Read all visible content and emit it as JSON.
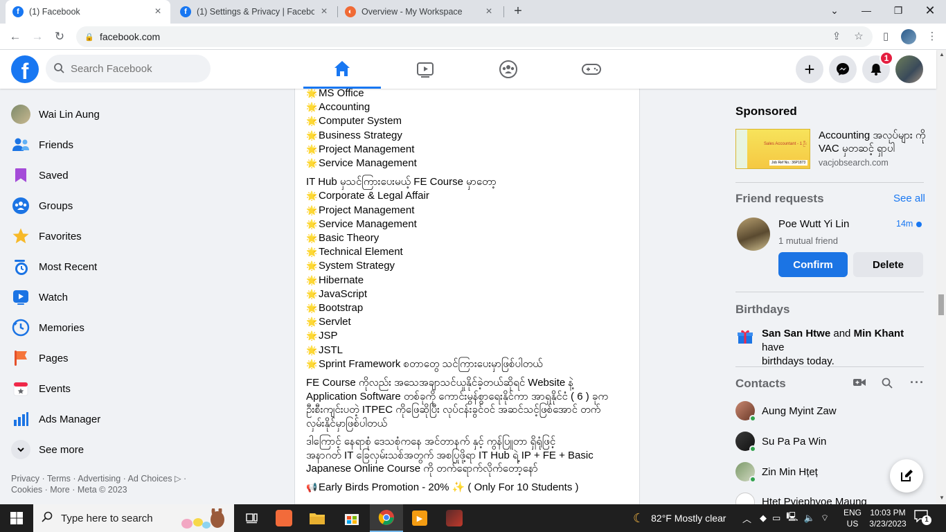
{
  "browser": {
    "tabs": [
      {
        "title": "(1) Facebook",
        "active": true
      },
      {
        "title": "(1) Settings & Privacy | Facebook",
        "active": false
      },
      {
        "title": "Overview - My Workspace",
        "active": false
      }
    ],
    "url": "facebook.com"
  },
  "header": {
    "logo": "f",
    "search_placeholder": "Search Facebook",
    "notification_count": "1"
  },
  "sidebar": {
    "items": [
      {
        "label": "Wai Lin Aung",
        "icon": "profile-avatar"
      },
      {
        "label": "Friends",
        "icon": "friends-icon"
      },
      {
        "label": "Saved",
        "icon": "saved-icon"
      },
      {
        "label": "Groups",
        "icon": "groups-icon"
      },
      {
        "label": "Favorites",
        "icon": "favorites-icon"
      },
      {
        "label": "Most Recent",
        "icon": "most-recent-icon"
      },
      {
        "label": "Watch",
        "icon": "watch-icon"
      },
      {
        "label": "Memories",
        "icon": "memories-icon"
      },
      {
        "label": "Pages",
        "icon": "pages-icon"
      },
      {
        "label": "Events",
        "icon": "events-icon"
      },
      {
        "label": "Ads Manager",
        "icon": "ads-manager-icon"
      },
      {
        "label": "See more",
        "icon": "chevron-down-icon"
      }
    ],
    "footer_line1": "Privacy · Terms · Advertising · Ad Choices ▷ ·",
    "footer_line2": "Cookies · More · Meta © 2023"
  },
  "post": {
    "list1": [
      "MS Office",
      "Accounting",
      "Computer System",
      "Business Strategy",
      "Project Management",
      "Service Management"
    ],
    "fe_intro": "IT Hub မှသင်ကြားပေးမယ့် FE Course မှာတော့",
    "list2": [
      "Corporate & Legal Affair",
      "Project Management",
      "Service Management",
      "Basic Theory",
      "Technical Element",
      "System Strategy",
      "Hibernate",
      "JavaScript",
      "Bootstrap",
      "Servlet",
      "JSP",
      "JSTL",
      "Sprint Framework စတာတွေ သင်ကြားပေးမှာဖြစ်ပါတယ်"
    ],
    "para1_line1": "FE Course ကိုလည်း အသေအချာသင်ယူနိုင်ခဲ့တယ်ဆိုရင် Website နဲ့",
    "para1_line2": "Application Software တစ်ခုကို ကောင်းမွန်စွာရေးနိုင်ကာ အာရှနိုင်ငံ ( 6 ) ခုက",
    "para1_line3": "ဦးစီးကျင်းပတဲ့ ITPEC ကိုဖြေဆိုပြီး လုပ်ငန်းခွင်ဝင် အဆင်သင့်ဖြစ်အောင် တက်",
    "para1_line4": "လှမ်းနိုင်မှာဖြစ်ပါတယ်",
    "para2_line1": "ဒါကြောင့် နေရာစုံ ဒေသစုံကနေ အင်တာနက် နှင့် ကွန်ပြူတာ ရှိရုံဖြင့်",
    "para2_line2": "အနာဂတ် IT ခြေလှမ်းသစ်အတွက် အစပြုဖို့ရာ IT Hub ရဲ့ IP + FE + Basic",
    "para2_line3": "Japanese Online Course ကို တက်ရောက်လိုက်တော့နော်",
    "promo": "Early Birds Promotion - 20% ✨ ( Only For 10 Students )"
  },
  "right": {
    "sponsored_title": "Sponsored",
    "ad_title": "Accounting အလုပ်များ ကို VAC မှတဆင့် ရှာပါ",
    "ad_domain": "vacjobsearch.com",
    "ad_thumb_text": "Sales Accountant - 1 ဦး",
    "ad_thumb_ref": "Job Ref No.: 36P1873",
    "friend_requests_title": "Friend requests",
    "see_all": "See all",
    "fr_name": "Poe Wutt Yi Lin",
    "fr_time": "14m",
    "fr_mutual": "1 mutual friend",
    "confirm": "Confirm",
    "delete": "Delete",
    "birthdays_title": "Birthdays",
    "bd_name1": "San San Htwe",
    "bd_and": " and ",
    "bd_name2": "Min Khant",
    "bd_suffix": " have",
    "bd_line2": "birthdays today.",
    "contacts_title": "Contacts",
    "contacts": [
      "Aung Myint Zaw",
      "Su Pa Pa Win",
      "Zin Min Hțeț",
      "Htet Pyiephyoe Maung"
    ]
  },
  "taskbar": {
    "search_placeholder": "Type here to search",
    "weather": "82°F  Mostly clear",
    "lang1": "ENG",
    "lang2": "US",
    "time": "10:03 PM",
    "date": "3/23/2023",
    "notif_count": "1"
  },
  "colors": {
    "fb_blue": "#1877f2",
    "confirm_blue": "#1b74e4",
    "notif_red": "#e41e3f",
    "online_green": "#31a24c"
  }
}
